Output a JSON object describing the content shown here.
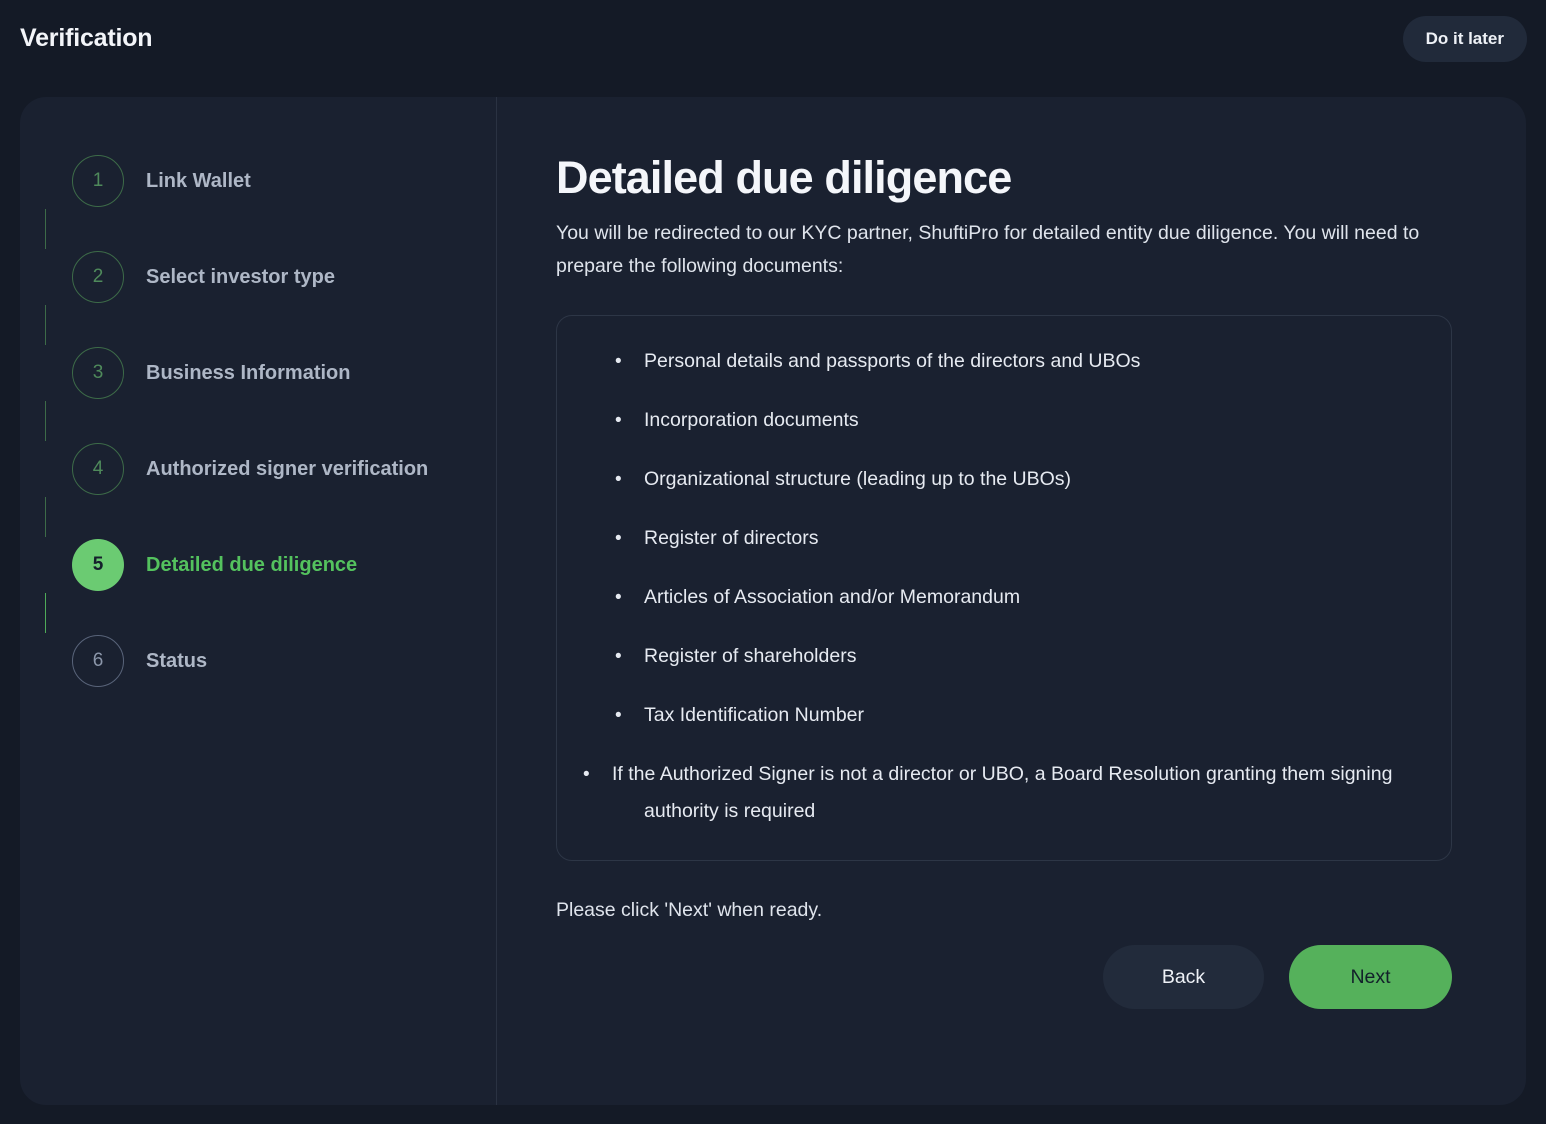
{
  "header": {
    "title": "Verification",
    "do_it_later_label": "Do it later"
  },
  "stepper": {
    "steps": [
      {
        "number": "1",
        "label": "Link Wallet",
        "state": "done"
      },
      {
        "number": "2",
        "label": "Select investor type",
        "state": "done"
      },
      {
        "number": "3",
        "label": "Business Information",
        "state": "done"
      },
      {
        "number": "4",
        "label": "Authorized signer verification",
        "state": "done"
      },
      {
        "number": "5",
        "label": "Detailed due diligence",
        "state": "active"
      },
      {
        "number": "6",
        "label": "Status",
        "state": "todo"
      }
    ]
  },
  "main": {
    "title": "Detailed due diligence",
    "intro": "You will be redirected to our KYC partner, ShuftiPro for detailed entity due diligence. You will need to prepare the following documents:",
    "documents": [
      "Personal details and passports of the directors and UBOs",
      "Incorporation documents",
      "Organizational structure (leading up to the UBOs)",
      "Register of directors",
      "Articles of Association and/or Memorandum",
      "Register of shareholders",
      "Tax Identification Number",
      "If the Authorized Signer is not a director or UBO, a Board Resolution granting them signing authority is required"
    ],
    "ready_note": "Please click 'Next' when ready.",
    "back_label": "Back",
    "next_label": "Next"
  },
  "colors": {
    "page_background": "#141a26",
    "panel_background": "#1a2130",
    "accent_green": "#55b15b",
    "active_step_green": "#6bcb72",
    "active_label_green": "#54c25e",
    "done_step_green": "#3d6b48",
    "muted_text": "#aeb7c6"
  }
}
